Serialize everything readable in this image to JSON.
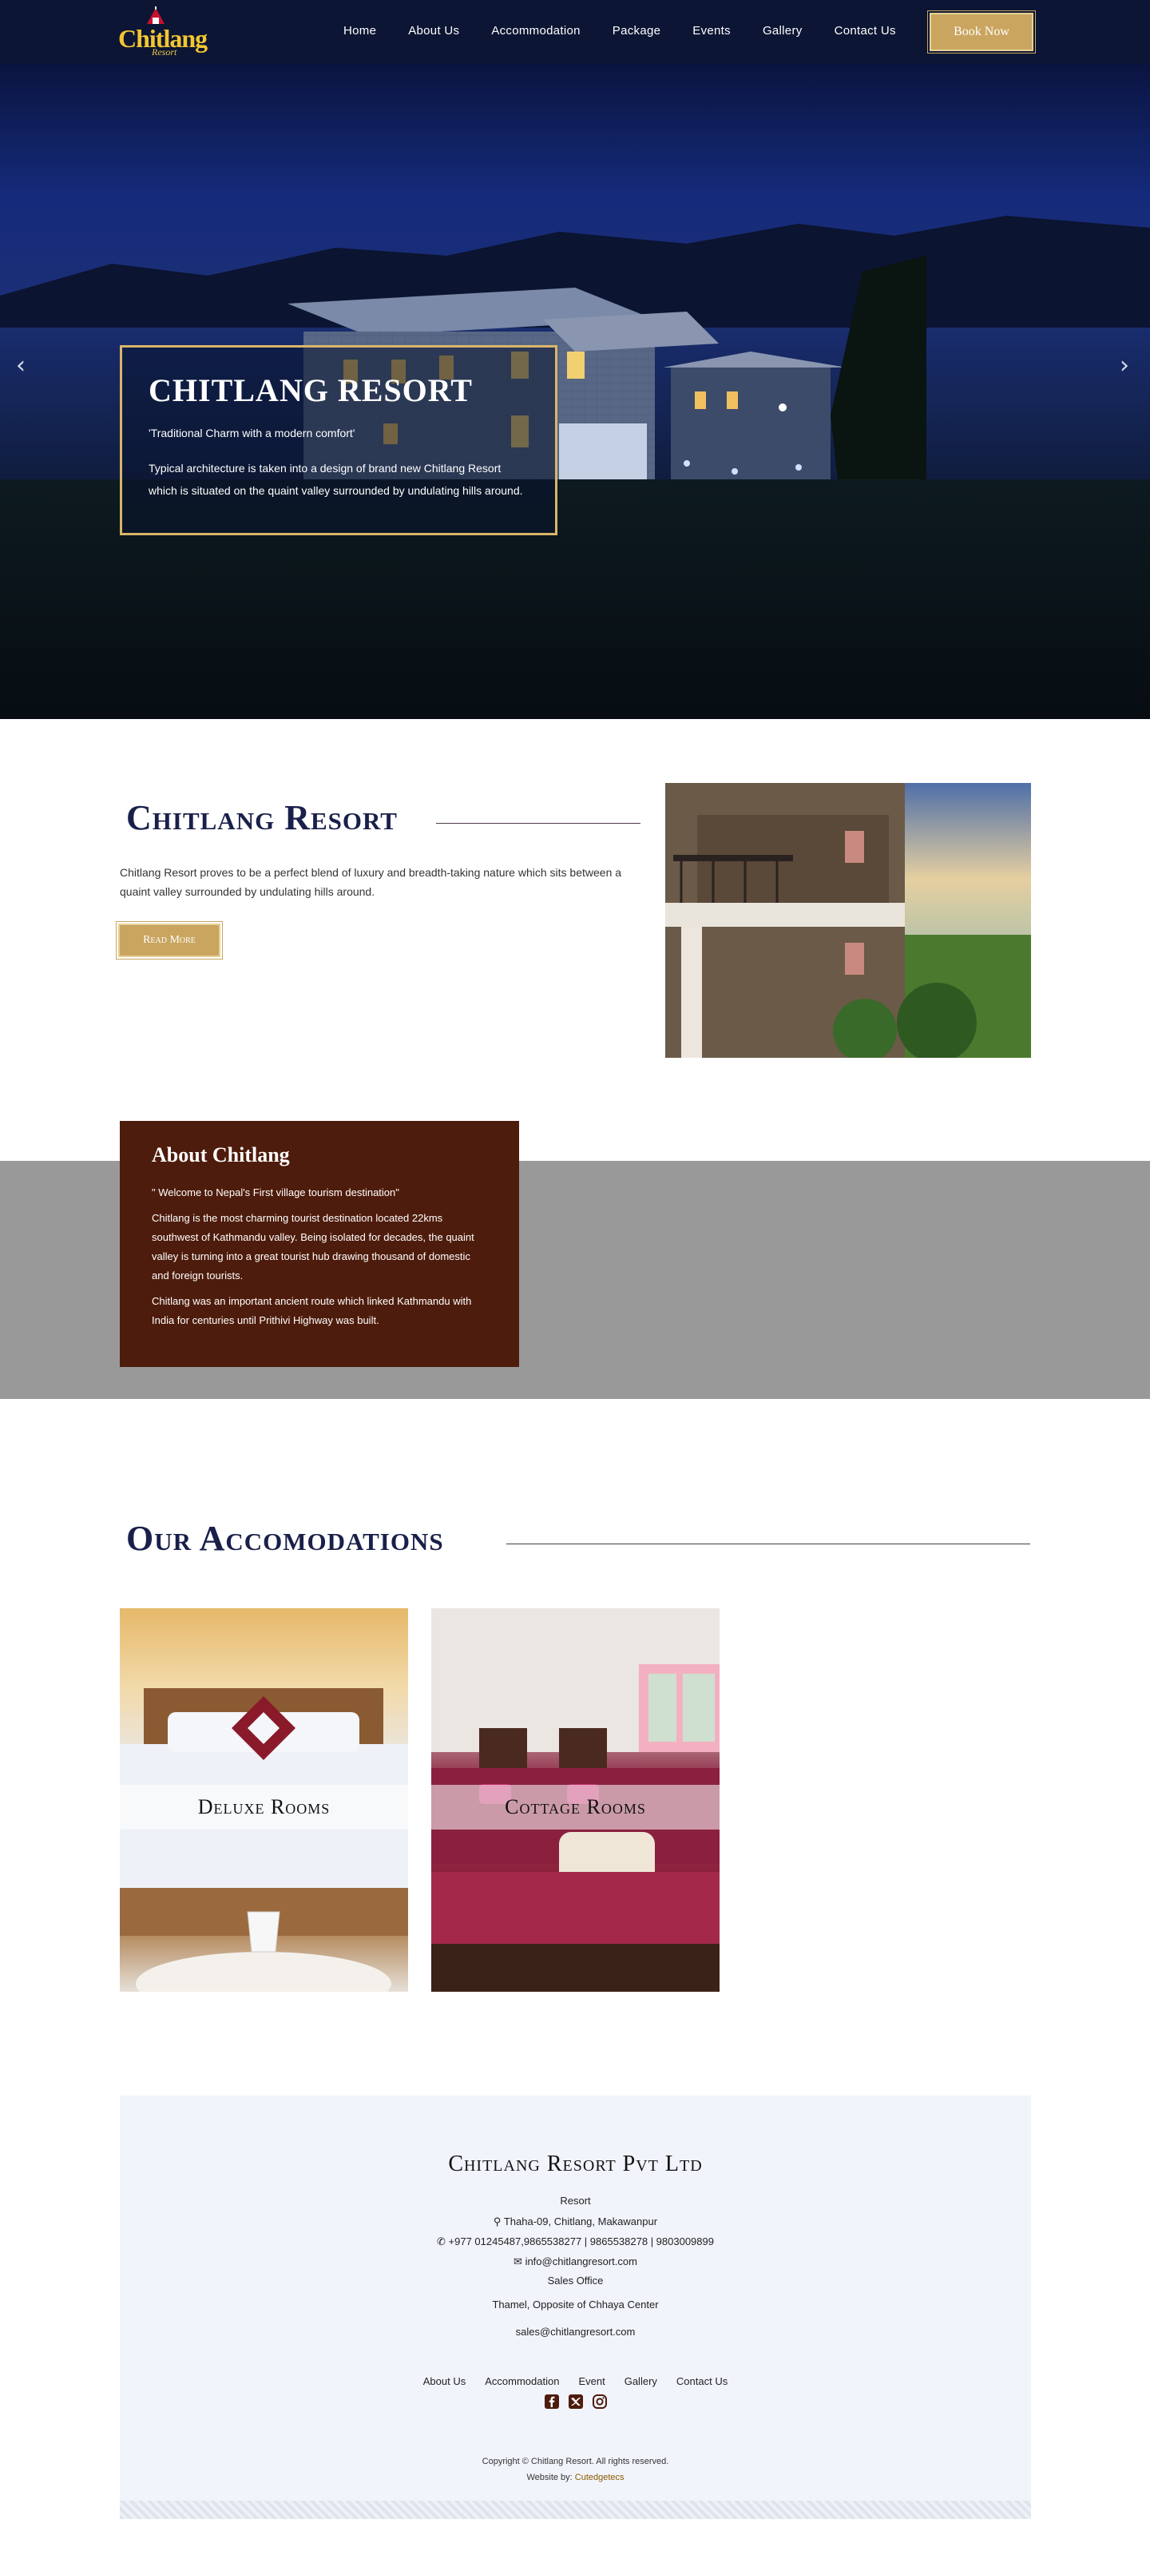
{
  "nav": {
    "logo_text": "Chitlang",
    "logo_sub": "Resort",
    "items": [
      {
        "label": "Home"
      },
      {
        "label": "About Us"
      },
      {
        "label": "Accommodation"
      },
      {
        "label": "Package"
      },
      {
        "label": "Events"
      },
      {
        "label": "Gallery"
      },
      {
        "label": "Contact Us"
      }
    ],
    "book_label": "Book Now"
  },
  "hero": {
    "title": "CHITLANG RESORT",
    "quote": "'Traditional Charm with a modern comfort'",
    "text": "Typical architecture is taken into a design of brand new Chitlang Resort which is situated on the quaint valley surrounded by undulating hills around.",
    "prev_arrow": "‹",
    "next_arrow": "›"
  },
  "intro": {
    "title": "Chitlang Resort",
    "text": "Chitlang Resort proves to be a perfect blend of luxury and breadth-taking nature which sits between a quaint valley surrounded by undulating hills around.",
    "button": "Read More"
  },
  "about": {
    "title": "About Chitlang",
    "quote": "\" Welcome to Nepal's First village tourism destination\"",
    "p1": "Chitlang is the most charming tourist destination located 22kms southwest of Kathmandu valley. Being isolated for decades, the quaint valley is turning into a great tourist hub drawing thousand of domestic and foreign tourists.",
    "p2": "Chitlang was an important ancient route which linked Kathmandu with India for centuries until Prithivi Highway was built."
  },
  "accommodations": {
    "title": "Our Accomodations",
    "rooms": [
      {
        "label": "Deluxe Rooms"
      },
      {
        "label": "Cottage Rooms"
      }
    ]
  },
  "footer": {
    "company": "Chitlang Resort Pvt Ltd",
    "resort_heading": "Resort",
    "address": "Thaha-09, Chitlang, Makawanpur",
    "phone": "+977 01245487,9865538277 | 9865538278 | 9803009899",
    "email": "info@chitlangresort.com",
    "sales_heading": "Sales Office",
    "sales_address": "Thamel, Opposite of Chhaya Center",
    "sales_email": "sales@chitlangresort.com",
    "links": [
      {
        "label": "About Us"
      },
      {
        "label": "Accommodation"
      },
      {
        "label": "Event"
      },
      {
        "label": "Gallery"
      },
      {
        "label": "Contact Us"
      }
    ],
    "social_icons": [
      "facebook-icon",
      "twitter-icon",
      "instagram-icon"
    ],
    "copyright": "Copyright © Chitlang Resort. All rights reserved.",
    "website_prefix": "Website by: ",
    "website_by": "Cutedgetecs"
  },
  "colors": {
    "nav_bg": "#0c1533",
    "gold": "#c9a55f",
    "heading_navy": "#19204a",
    "about_brown": "#4e1c0c",
    "band_gray": "#999999",
    "footer_bg": "#f1f4fb"
  }
}
